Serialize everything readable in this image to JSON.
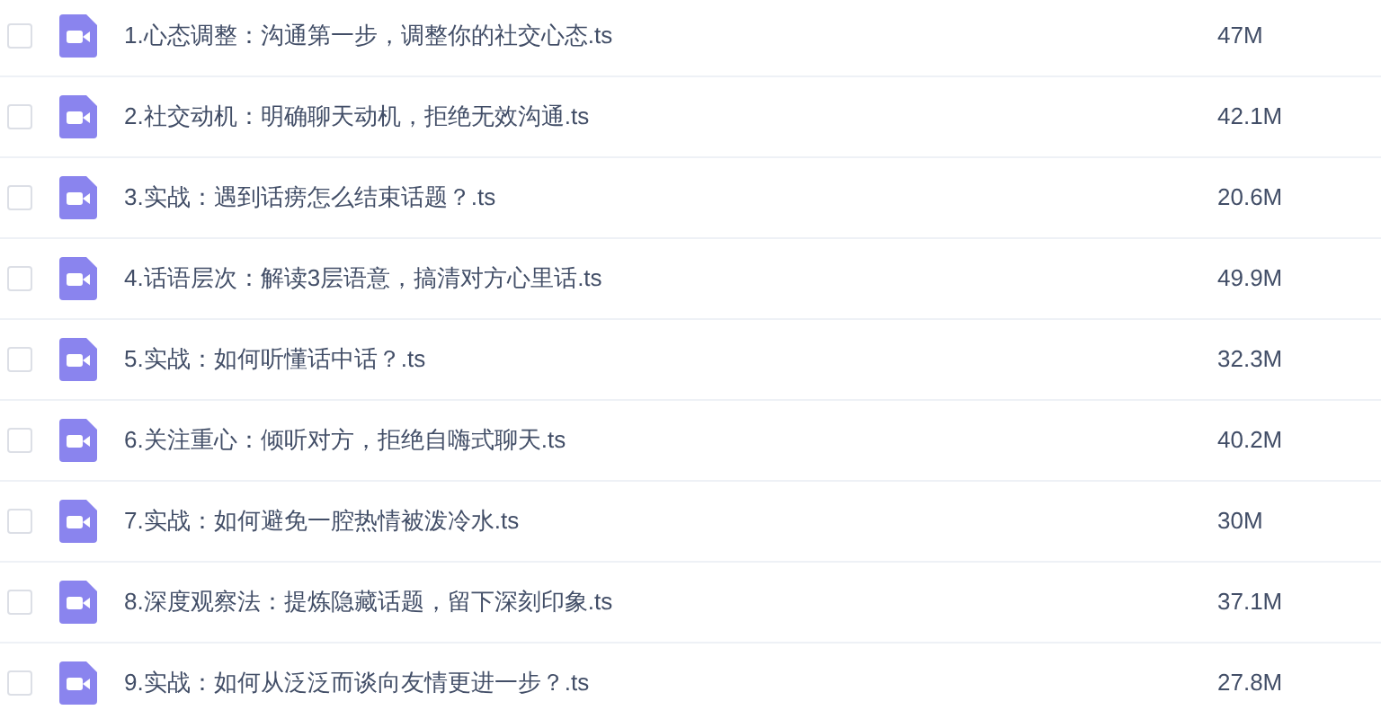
{
  "files": [
    {
      "name": "1.心态调整：沟通第一步，调整你的社交心态.ts",
      "size": "47M",
      "checked": false
    },
    {
      "name": "2.社交动机：明确聊天动机，拒绝无效沟通.ts",
      "size": "42.1M",
      "checked": false
    },
    {
      "name": "3.实战：遇到话痨怎么结束话题？.ts",
      "size": "20.6M",
      "checked": false
    },
    {
      "name": "4.话语层次：解读3层语意，搞清对方心里话.ts",
      "size": "49.9M",
      "checked": false
    },
    {
      "name": "5.实战：如何听懂话中话？.ts",
      "size": "32.3M",
      "checked": false
    },
    {
      "name": "6.关注重心：倾听对方，拒绝自嗨式聊天.ts",
      "size": "40.2M",
      "checked": false
    },
    {
      "name": "7.实战：如何避免一腔热情被泼冷水.ts",
      "size": "30M",
      "checked": false
    },
    {
      "name": "8.深度观察法：提炼隐藏话题，留下深刻印象.ts",
      "size": "37.1M",
      "checked": false
    },
    {
      "name": "9.实战：如何从泛泛而谈向友情更进一步？.ts",
      "size": "27.8M",
      "checked": false
    }
  ]
}
